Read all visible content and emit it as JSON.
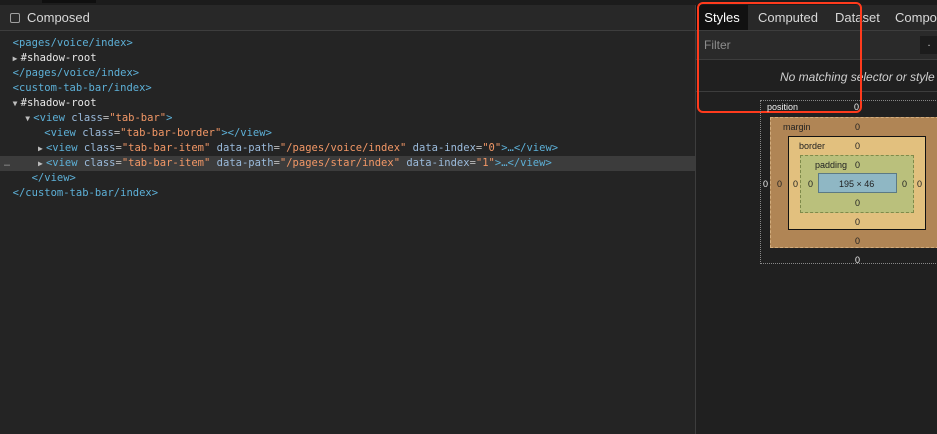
{
  "toolbar": {
    "composed_label": "Composed",
    "composed_checked": false
  },
  "dom_tree": {
    "lines": [
      {
        "open": "<",
        "tag": "pages/voice/index",
        "close": ">"
      },
      {
        "text": "#shadow-root"
      },
      {
        "open": "</",
        "tag": "pages/voice/index",
        "close": ">"
      },
      {
        "open": "<",
        "tag": "custom-tab-bar/index",
        "close": ">"
      },
      {
        "text": "#shadow-root"
      },
      {
        "tag": "view",
        "attr1": "class",
        "val1": "\"tab-bar\""
      },
      {
        "tag": "view",
        "attr1": "class",
        "val1": "\"tab-bar-border\"",
        "tail": "</view>"
      },
      {
        "tag": "view",
        "attr1": "class",
        "val1": "\"tab-bar-item\"",
        "attr2": "data-path",
        "val2": "\"/pages/voice/index\"",
        "attr3": "data-index",
        "val3": "\"0\"",
        "tail": "…</view>"
      },
      {
        "tag": "view",
        "attr1": "class",
        "val1": "\"tab-bar-item\"",
        "attr2": "data-path",
        "val2": "\"/pages/star/index\"",
        "attr3": "data-index",
        "val3": "\"1\"",
        "tail": "…</view>"
      },
      {
        "text": "</view>"
      },
      {
        "text": "</custom-tab-bar/index>"
      }
    ],
    "ellipsis": "…"
  },
  "styles_panel": {
    "tabs": [
      "Styles",
      "Computed",
      "Dataset",
      "Compo"
    ],
    "active_tab": "Styles",
    "filter_placeholder": "Filter",
    "more_button": ".",
    "no_match_text": "No matching selector or style"
  },
  "box_model": {
    "position_label": "position",
    "position": {
      "top": "0",
      "right": "0",
      "bottom": "0",
      "left": "0"
    },
    "margin_label": "margin",
    "margin": {
      "top": "0",
      "right": "0",
      "bottom": "0",
      "left": "0"
    },
    "border_label": "border",
    "border": {
      "top": "0",
      "right": "0",
      "bottom": "0",
      "left": "0"
    },
    "padding_label": "padding",
    "padding": {
      "top": "0",
      "right": "0",
      "bottom": "0",
      "left": "0"
    },
    "content_size": "195 × 46"
  },
  "colors": {
    "highlight": "#ff3b1d",
    "tag": "#5db0d7",
    "value": "#f29766",
    "attr": "#9bbbdc"
  }
}
